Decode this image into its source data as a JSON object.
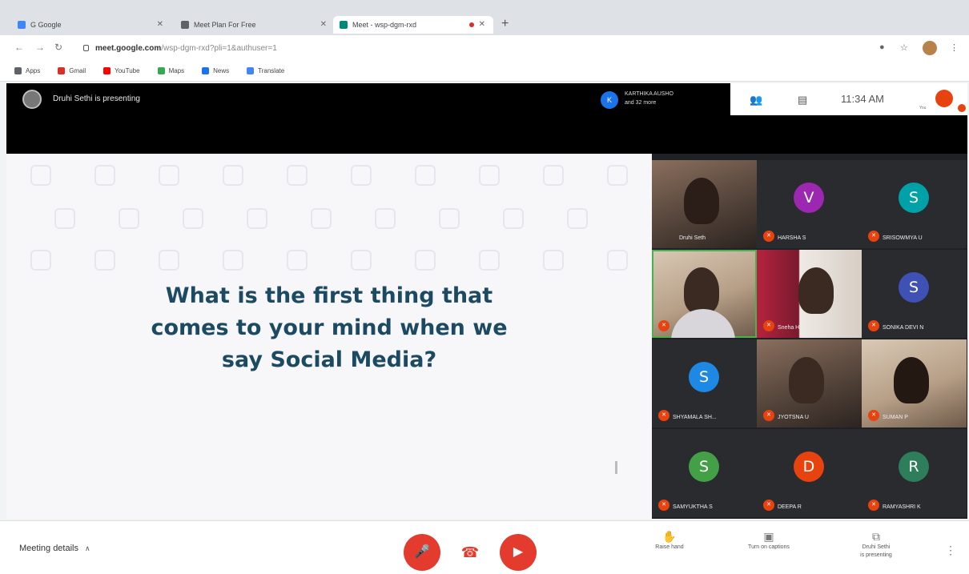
{
  "browser": {
    "tabs": [
      {
        "title": "G Google",
        "favicon_color": "#4285f4"
      },
      {
        "title": "Meet Plan For Free",
        "favicon_color": "#5f6368"
      },
      {
        "title": "Meet - wsp-dgm-rxd",
        "favicon_color": "#00897b"
      }
    ],
    "new_tab_label": "+",
    "url_host": "meet.google.com",
    "url_path": "/wsp-dgm-rxd?pli=1&authuser=1",
    "bookmarks": [
      {
        "label": "Apps",
        "color": "#5f6368"
      },
      {
        "label": "Gmail",
        "color": "#d93025"
      },
      {
        "label": "YouTube",
        "color": "#ff0000"
      },
      {
        "label": "Maps",
        "color": "#34a853"
      },
      {
        "label": "News",
        "color": "#1a73e8"
      },
      {
        "label": "Translate",
        "color": "#4285f4"
      }
    ]
  },
  "meet": {
    "presenter_text": "Druhi Sethi is presenting",
    "others": {
      "line1": "KARTHIKA AUSHO",
      "line2": "and 32 more"
    },
    "time": "11:34 AM",
    "you_label": "You",
    "slide": {
      "line1": "What is the first thing that",
      "line2": "comes to your mind when we",
      "line3": "say Social Media?"
    },
    "participants": [
      {
        "name": "Druhi Seth",
        "initial": "",
        "color": "",
        "video": true
      },
      {
        "name": "HARSHA S",
        "initial": "V",
        "color": "#9c27b0",
        "video": false
      },
      {
        "name": "SRISOWMYA U",
        "initial": "S",
        "color": "#00a1a7",
        "video": false
      },
      {
        "name": "",
        "initial": "",
        "color": "",
        "video": true
      },
      {
        "name": "Sneha H",
        "initial": "",
        "color": "",
        "video": true
      },
      {
        "name": "SONIKA DEVI N",
        "initial": "S",
        "color": "#3f51b5",
        "video": false
      },
      {
        "name": "SHYAMALA SH...",
        "initial": "S",
        "color": "#1e88e5",
        "video": false
      },
      {
        "name": "JYOTSNA U",
        "initial": "",
        "color": "",
        "video": true
      },
      {
        "name": "SUMAN P",
        "initial": "",
        "color": "",
        "video": true
      },
      {
        "name": "SAMYUKTHA S",
        "initial": "S",
        "color": "#43a047",
        "video": false
      },
      {
        "name": "DEEPA R",
        "initial": "D",
        "color": "#e8430f",
        "video": false
      },
      {
        "name": "RAMYASHRI K",
        "initial": "R",
        "color": "#2e7d5b",
        "video": false
      }
    ],
    "controls": {
      "meeting_details": "Meeting details",
      "raise_hand": "Raise hand",
      "captions": "Turn on captions",
      "presenting_line1": "Druhi Sethi",
      "presenting_line2": "is presenting"
    }
  }
}
